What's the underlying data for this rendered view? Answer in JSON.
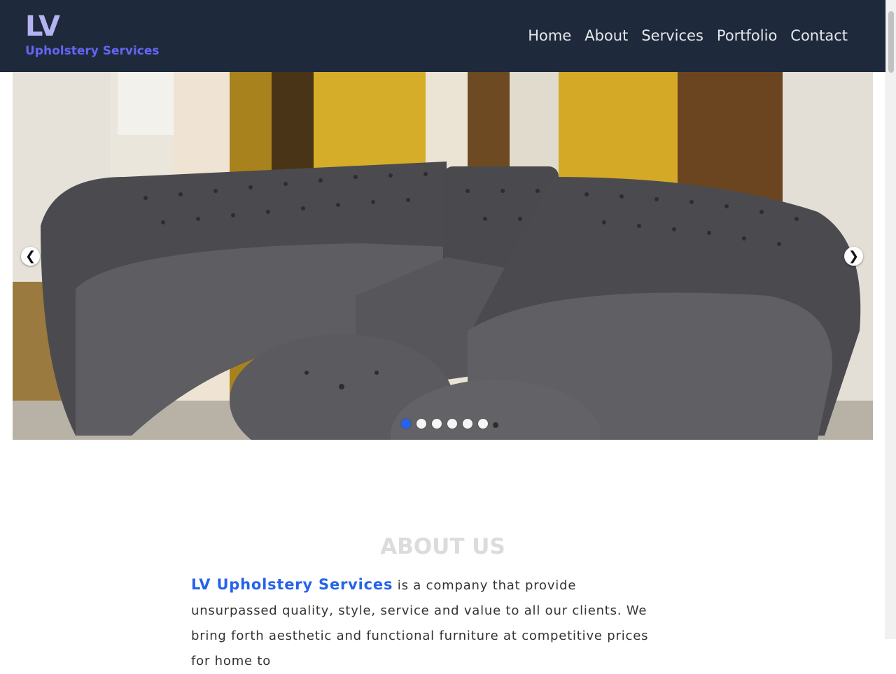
{
  "brand": {
    "mono": "LV",
    "subtitle": "Upholstery Services"
  },
  "nav": [
    {
      "label": "Home"
    },
    {
      "label": "About"
    },
    {
      "label": "Services"
    },
    {
      "label": "Portfolio"
    },
    {
      "label": "Contact"
    }
  ],
  "carousel": {
    "prev_glyph": "❮",
    "next_glyph": "❯",
    "slide_count": 6,
    "active_index": 0,
    "image_alt": "Grey tufted sectional sofa with ottomans"
  },
  "about": {
    "title": "ABOUT US",
    "company": "LV Upholstery Services",
    "text": " is a company that provide unsurpassed quality, style, service and value to all our clients. We bring forth aesthetic and functional furniture at competitive prices for home to"
  },
  "colors": {
    "navbar_bg": "#1e293b",
    "brand_mono": "#b6b3f2",
    "brand_sub": "#6366f1",
    "accent": "#2563eb"
  }
}
